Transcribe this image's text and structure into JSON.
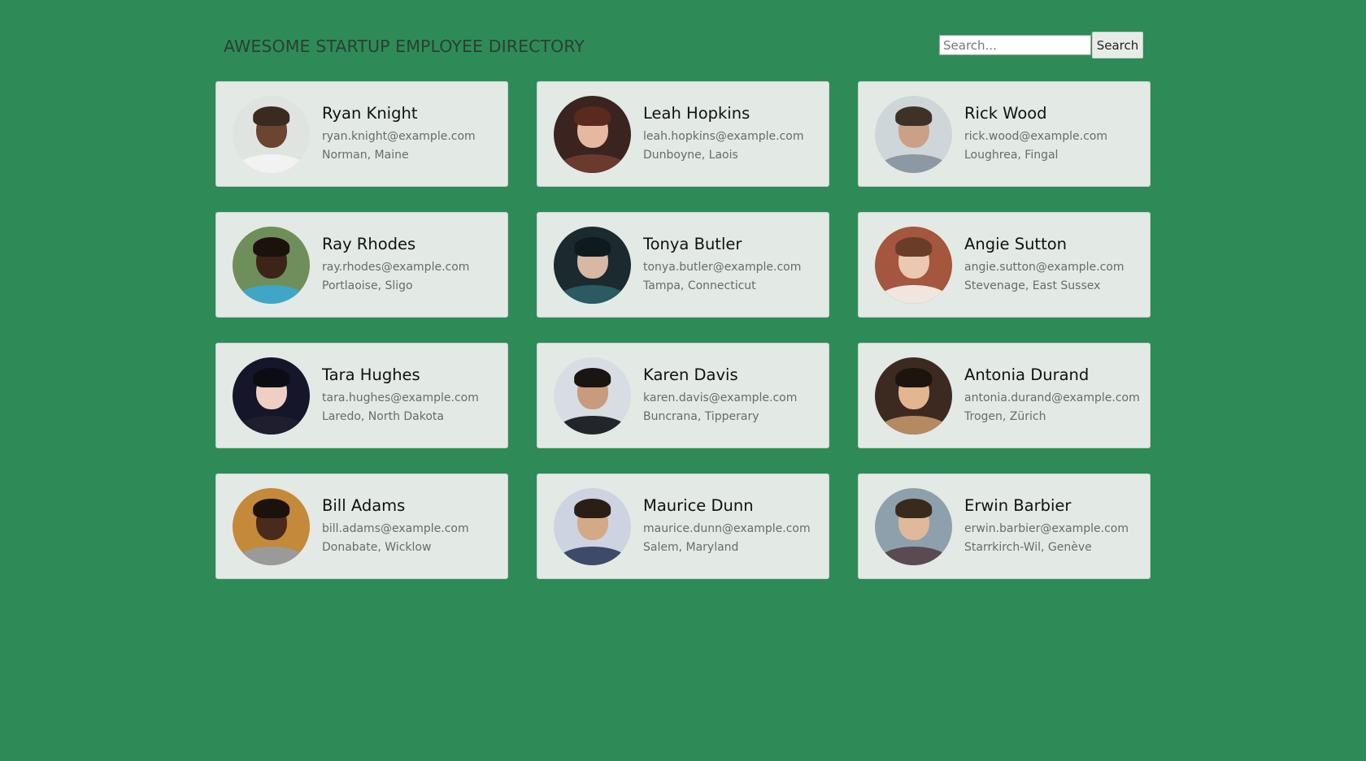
{
  "header": {
    "title": "AWESOME STARTUP EMPLOYEE DIRECTORY"
  },
  "search": {
    "placeholder": "Search...",
    "button_label": "Search"
  },
  "employees": [
    {
      "name": "Ryan Knight",
      "email": "ryan.knight@example.com",
      "location": "Norman, Maine",
      "avatar": {
        "bg": "#dfe4e0",
        "skin": "#6b4530",
        "hair": "#3a2a20",
        "shirt": "#f2f2f2"
      }
    },
    {
      "name": "Leah Hopkins",
      "email": "leah.hopkins@example.com",
      "location": "Dunboyne, Laois",
      "avatar": {
        "bg": "#3b2320",
        "skin": "#e7b8a0",
        "hair": "#5a2a1e",
        "shirt": "#6a3a2e"
      }
    },
    {
      "name": "Rick Wood",
      "email": "rick.wood@example.com",
      "location": "Loughrea, Fingal",
      "avatar": {
        "bg": "#cfd6da",
        "skin": "#caa186",
        "hair": "#3e3128",
        "shirt": "#8c98a3"
      }
    },
    {
      "name": "Ray Rhodes",
      "email": "ray.rhodes@example.com",
      "location": "Portlaoise, Sligo",
      "avatar": {
        "bg": "#6f8f5a",
        "skin": "#3d2418",
        "hair": "#1c120d",
        "shirt": "#3fa6c8"
      }
    },
    {
      "name": "Tonya Butler",
      "email": "tonya.butler@example.com",
      "location": "Tampa, Connecticut",
      "avatar": {
        "bg": "#1a2a2e",
        "skin": "#d7b8a4",
        "hair": "#0f1a1e",
        "shirt": "#2a5a62"
      }
    },
    {
      "name": "Angie Sutton",
      "email": "angie.sutton@example.com",
      "location": "Stevenage, East Sussex",
      "avatar": {
        "bg": "#a4563f",
        "skin": "#ecc7b2",
        "hair": "#6a3d28",
        "shirt": "#f0e6df"
      }
    },
    {
      "name": "Tara Hughes",
      "email": "tara.hughes@example.com",
      "location": "Laredo, North Dakota",
      "avatar": {
        "bg": "#16162a",
        "skin": "#f0cfc3",
        "hair": "#0c0c14",
        "shirt": "#1e1e2c"
      }
    },
    {
      "name": "Karen Davis",
      "email": "karen.davis@example.com",
      "location": "Buncrana, Tipperary",
      "avatar": {
        "bg": "#d7dde2",
        "skin": "#c89a7e",
        "hair": "#1a1412",
        "shirt": "#22252a"
      }
    },
    {
      "name": "Antonia Durand",
      "email": "antonia.durand@example.com",
      "location": "Trogen, Zürich",
      "avatar": {
        "bg": "#3c2a20",
        "skin": "#e2b690",
        "hair": "#1e140e",
        "shirt": "#b58a62"
      }
    },
    {
      "name": "Bill Adams",
      "email": "bill.adams@example.com",
      "location": "Donabate, Wicklow",
      "avatar": {
        "bg": "#c48a3a",
        "skin": "#4a2a1a",
        "hair": "#1c120c",
        "shirt": "#9a9a9a"
      }
    },
    {
      "name": "Maurice Dunn",
      "email": "maurice.dunn@example.com",
      "location": "Salem, Maryland",
      "avatar": {
        "bg": "#cdd3e0",
        "skin": "#d3a986",
        "hair": "#2a1e16",
        "shirt": "#3d4a6a"
      }
    },
    {
      "name": "Erwin Barbier",
      "email": "erwin.barbier@example.com",
      "location": "Starrkirch-Wil, Genève",
      "avatar": {
        "bg": "#8ea0ab",
        "skin": "#e0b89c",
        "hair": "#3a2a1e",
        "shirt": "#5a4a52"
      }
    }
  ]
}
